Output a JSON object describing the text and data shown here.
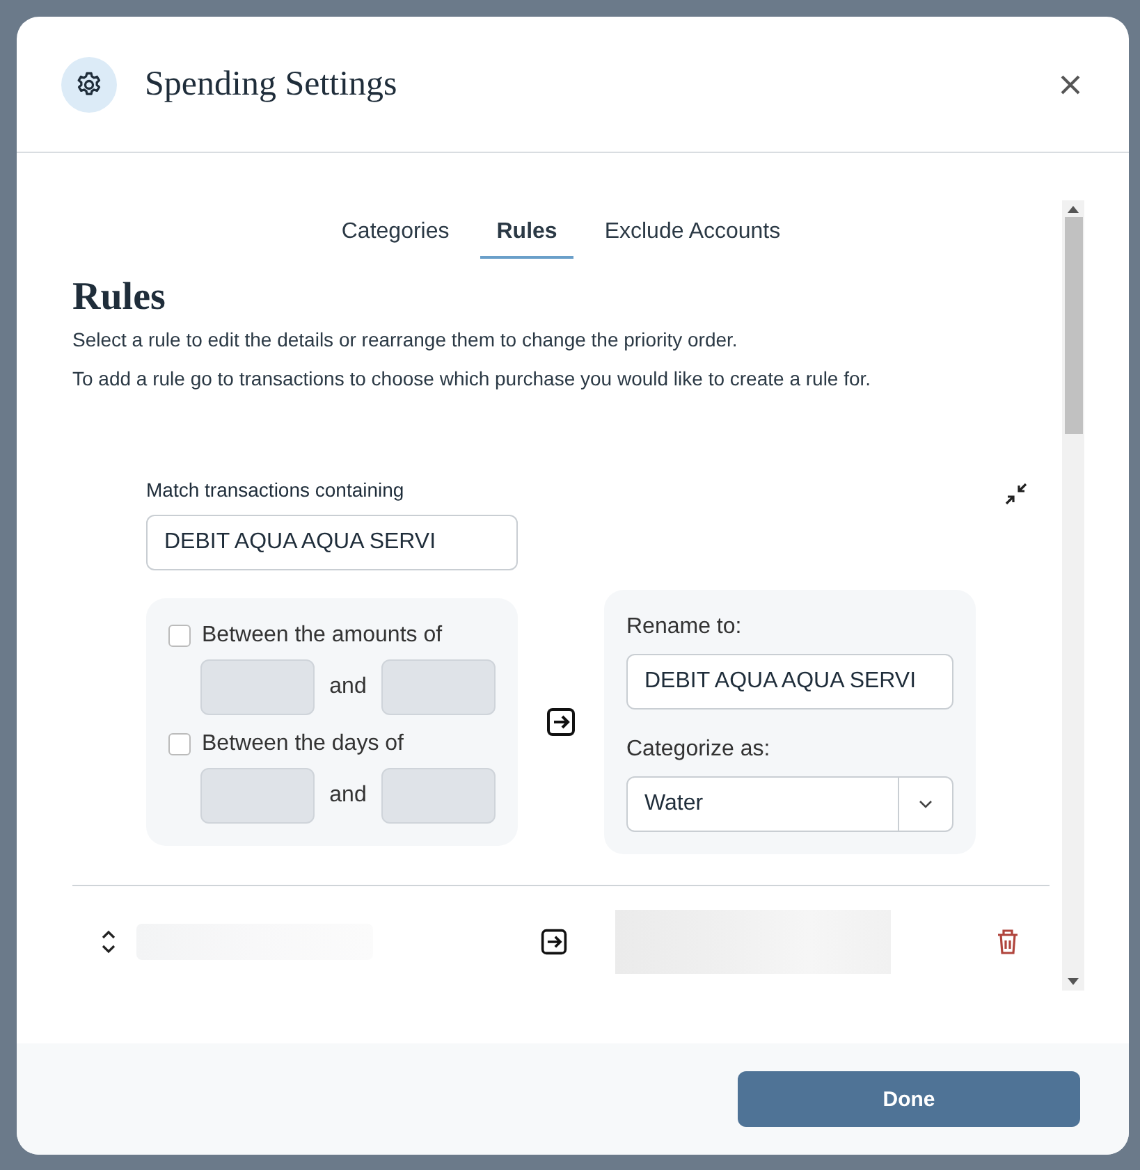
{
  "dialog": {
    "title": "Spending Settings"
  },
  "tabs": [
    {
      "label": "Categories",
      "selected": false
    },
    {
      "label": "Rules",
      "selected": true
    },
    {
      "label": "Exclude Accounts",
      "selected": false
    }
  ],
  "section": {
    "heading": "Rules",
    "descriptions": [
      "Select a rule to edit the details or rearrange them to change the priority order.",
      "To add a rule go to transactions to choose which purchase you would like to create a rule for."
    ]
  },
  "rule_editor": {
    "match_label": "Match transactions containing",
    "match_value": "DEBIT AQUA AQUA SERVI",
    "conditions": [
      {
        "label": "Between the amounts of",
        "checked": false,
        "joiner": "and"
      },
      {
        "label": "Between the days of",
        "checked": false,
        "joiner": "and"
      }
    ],
    "rename_label": "Rename to:",
    "rename_value": "DEBIT AQUA AQUA SERVI",
    "category_label": "Categorize as:",
    "category_value": "Water"
  },
  "collapsed_rules": [
    {
      "kind": "redacted"
    }
  ],
  "footer": {
    "done": "Done"
  }
}
